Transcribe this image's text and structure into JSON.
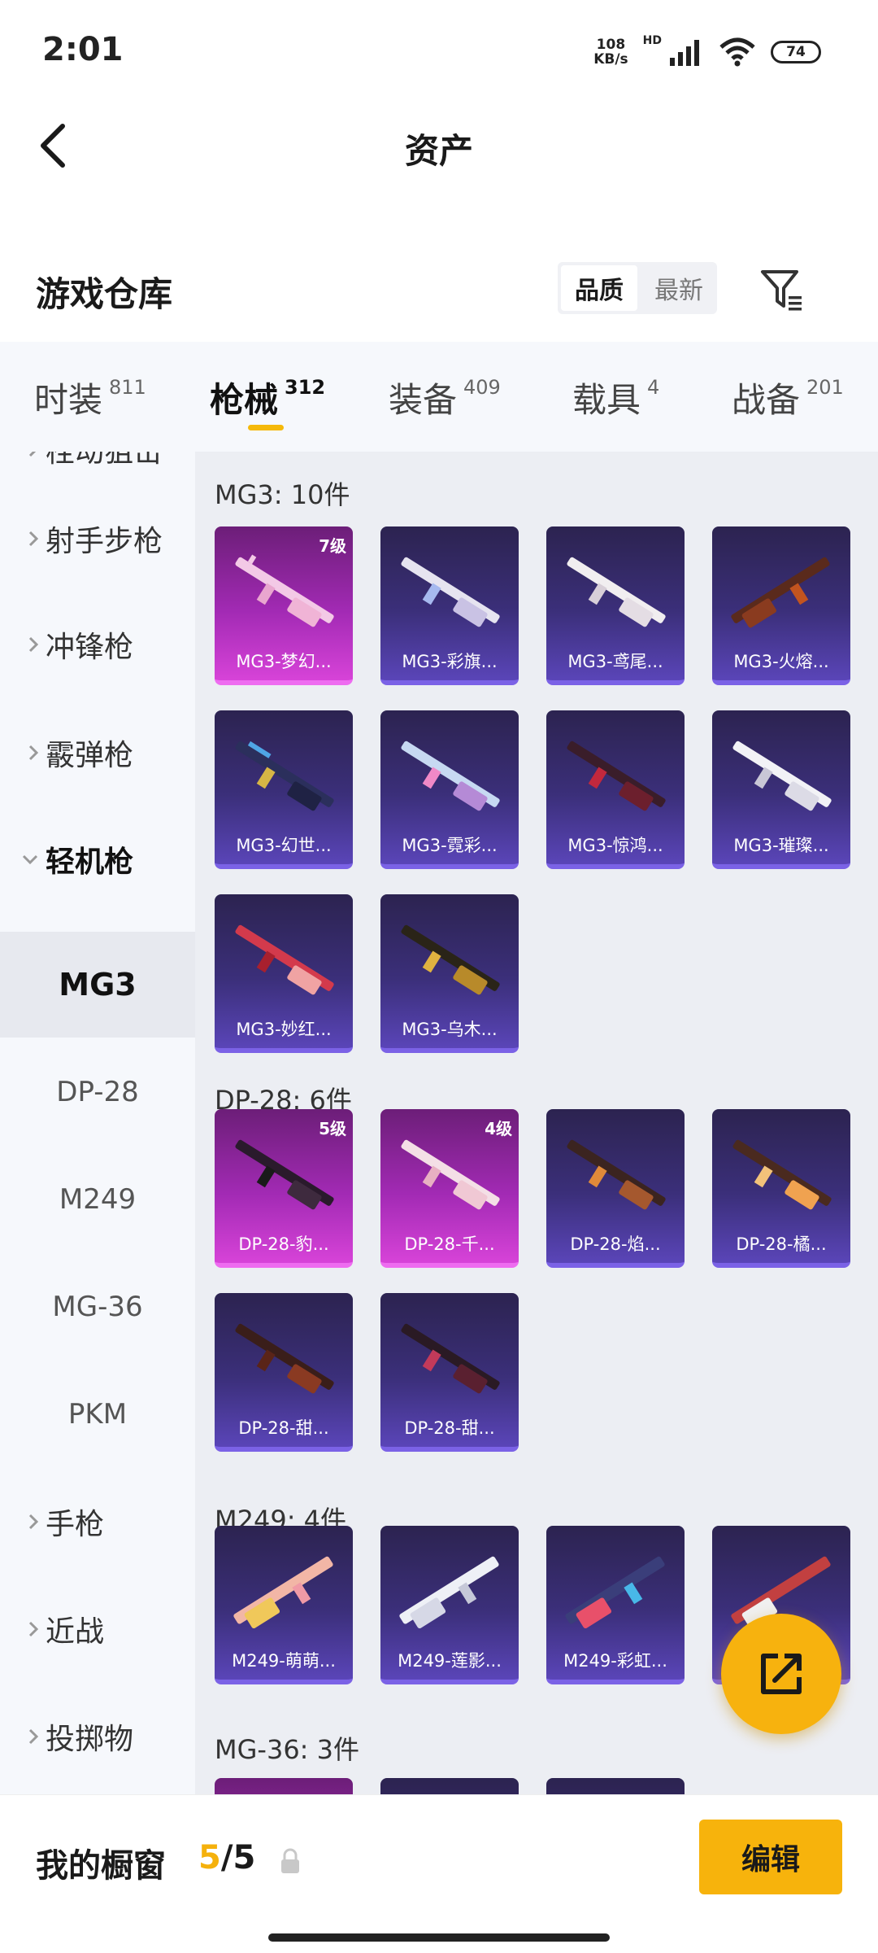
{
  "status": {
    "time": "2:01",
    "net_speed_value": "108",
    "net_speed_unit": "KB/s",
    "hd": "HD",
    "battery": "74"
  },
  "header": {
    "title": "资产"
  },
  "warehouse": {
    "title": "游戏仓库",
    "sort_quality": "品质",
    "sort_newest": "最新"
  },
  "tabs": [
    {
      "label": "时装",
      "count": "811"
    },
    {
      "label": "枪械",
      "count": "312"
    },
    {
      "label": "装备",
      "count": "409"
    },
    {
      "label": "载具",
      "count": "4"
    },
    {
      "label": "战备",
      "count": "201"
    }
  ],
  "sidebar": {
    "cut_item": "栓动狙击",
    "items": [
      {
        "label": "射手步枪"
      },
      {
        "label": "冲锋枪"
      },
      {
        "label": "霰弹枪"
      },
      {
        "label": "轻机枪"
      }
    ],
    "sub_items": [
      "MG3",
      "DP-28",
      "M249",
      "MG-36",
      "PKM"
    ],
    "items_after": [
      {
        "label": "手枪"
      },
      {
        "label": "近战"
      },
      {
        "label": "投掷物"
      }
    ]
  },
  "groups": [
    {
      "title": "MG3: 10件",
      "items": [
        {
          "name": "MG3-梦幻...",
          "level": "7级"
        },
        {
          "name": "MG3-彩旗...",
          "level": ""
        },
        {
          "name": "MG3-鸢尾...",
          "level": ""
        },
        {
          "name": "MG3-火熔...",
          "level": ""
        },
        {
          "name": "MG3-幻世...",
          "level": ""
        },
        {
          "name": "MG3-霓彩...",
          "level": ""
        },
        {
          "name": "MG3-惊鸿...",
          "level": ""
        },
        {
          "name": "MG3-璀璨...",
          "level": ""
        },
        {
          "name": "MG3-妙红...",
          "level": ""
        },
        {
          "name": "MG3-乌木...",
          "level": ""
        }
      ]
    },
    {
      "title": "DP-28: 6件",
      "items": [
        {
          "name": "DP-28-豹...",
          "level": "5级"
        },
        {
          "name": "DP-28-千...",
          "level": "4级"
        },
        {
          "name": "DP-28-焰...",
          "level": ""
        },
        {
          "name": "DP-28-橘...",
          "level": ""
        },
        {
          "name": "DP-28-甜...",
          "level": ""
        },
        {
          "name": "DP-28-甜...",
          "level": ""
        }
      ]
    },
    {
      "title": "M249: 4件",
      "items": [
        {
          "name": "M249-萌萌...",
          "level": ""
        },
        {
          "name": "M249-莲影...",
          "level": ""
        },
        {
          "name": "M249-彩虹...",
          "level": ""
        },
        {
          "name": "",
          "level": ""
        }
      ]
    },
    {
      "title": "MG-36: 3件",
      "items": []
    }
  ],
  "bottom": {
    "label": "我的橱窗",
    "current": "5",
    "total": "/5",
    "edit": "编辑"
  }
}
